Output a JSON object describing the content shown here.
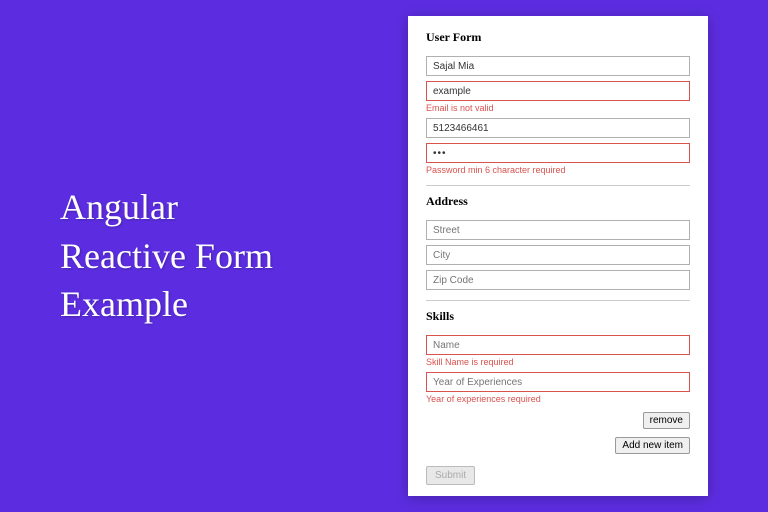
{
  "headline": "Angular\nReactive Form\nExample",
  "form": {
    "user": {
      "title": "User Form",
      "name_value": "Sajal Mia",
      "email_value": "example",
      "email_error": "Email is not valid",
      "phone_value": "5123466461",
      "password_value": "•••",
      "password_error": "Password min 6 character required"
    },
    "address": {
      "title": "Address",
      "street_placeholder": "Street",
      "city_placeholder": "City",
      "zip_placeholder": "Zip Code"
    },
    "skills": {
      "title": "Skills",
      "name_placeholder": "Name",
      "name_error": "Skill Name is required",
      "years_placeholder": "Year of Experiences",
      "years_error": "Year of experiences required",
      "remove_label": "remove",
      "add_label": "Add new item"
    },
    "submit_label": "Submit"
  }
}
